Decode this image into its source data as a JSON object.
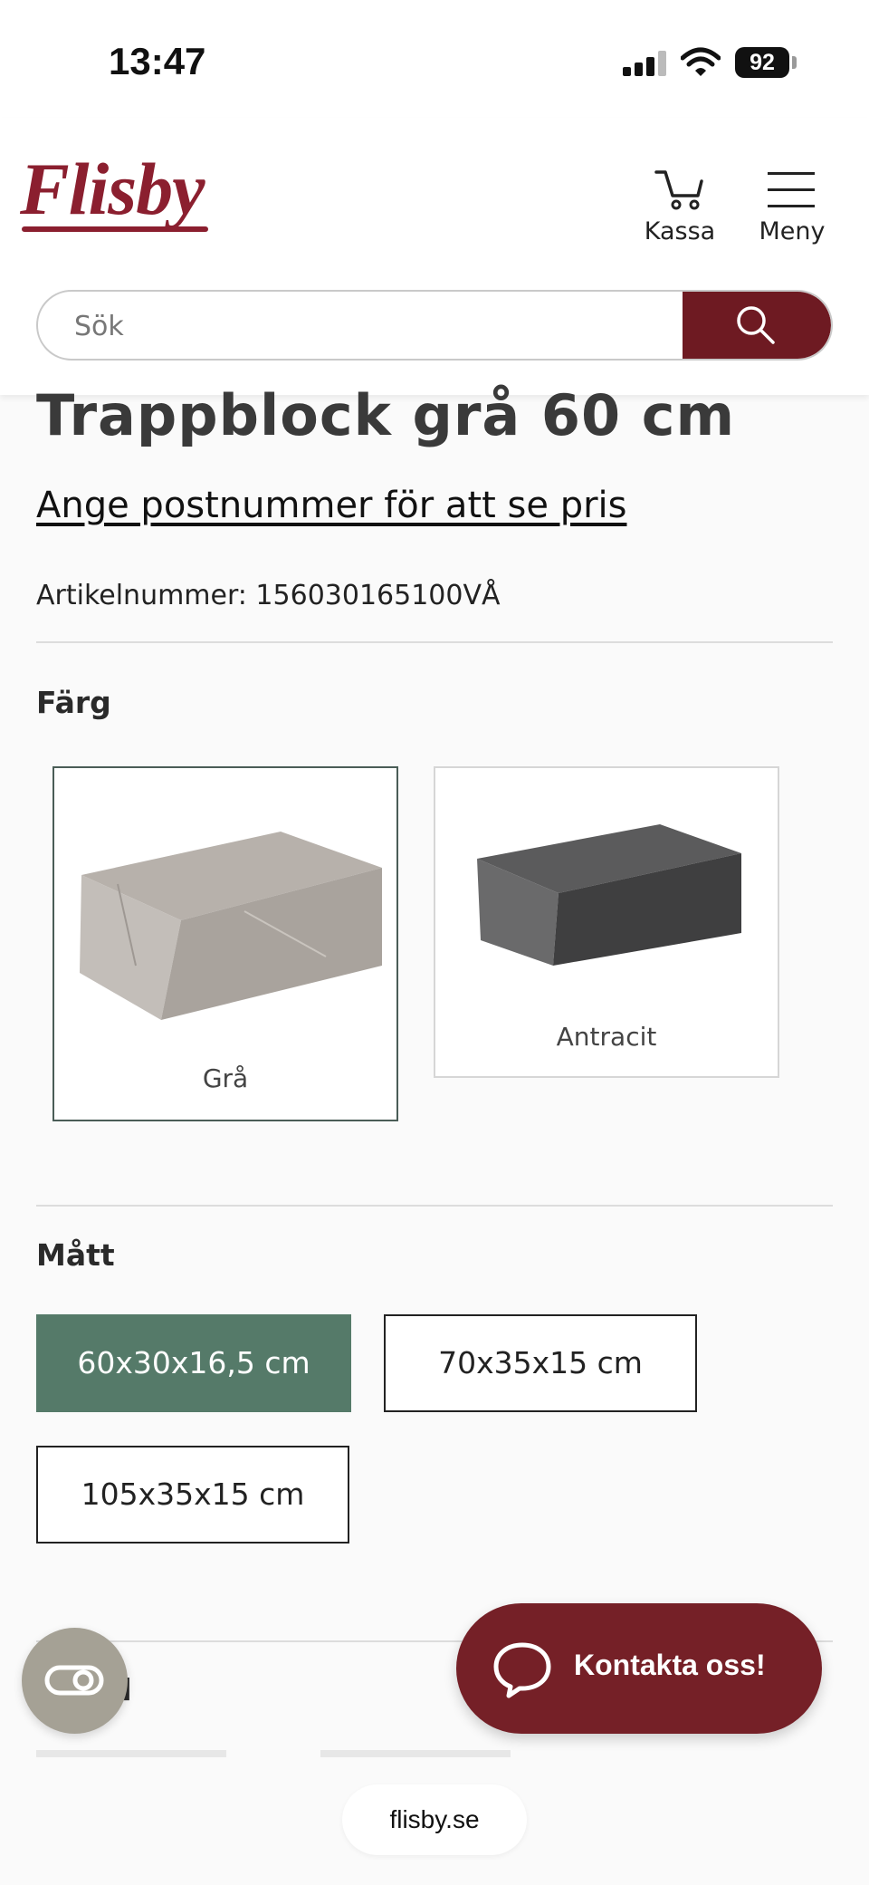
{
  "status_bar": {
    "time": "13:47",
    "battery": "92"
  },
  "header": {
    "logo_text": "Flisby",
    "kassa_label": "Kassa",
    "meny_label": "Meny",
    "brand_color": "#8b1f2f"
  },
  "search": {
    "placeholder": "Sök"
  },
  "product": {
    "title": "Trappblock grå 60 cm",
    "price_link": "Ange postnummer för att se pris",
    "article_number": "Artikelnummer: 156030165100VÅ"
  },
  "color_section": {
    "title": "Färg",
    "options": [
      {
        "label": "Grå",
        "selected": true
      },
      {
        "label": "Antracit",
        "selected": false
      }
    ]
  },
  "size_section": {
    "title": "Mått",
    "options": [
      {
        "label": "60x30x16,5 cm",
        "selected": true
      },
      {
        "label": "70x35x15 cm",
        "selected": false
      },
      {
        "label": "105x35x15 cm",
        "selected": false
      }
    ]
  },
  "next_section": {
    "partial_title": "d"
  },
  "chat": {
    "label": "Kontakta oss!"
  },
  "browser": {
    "url": "flisby.se"
  }
}
